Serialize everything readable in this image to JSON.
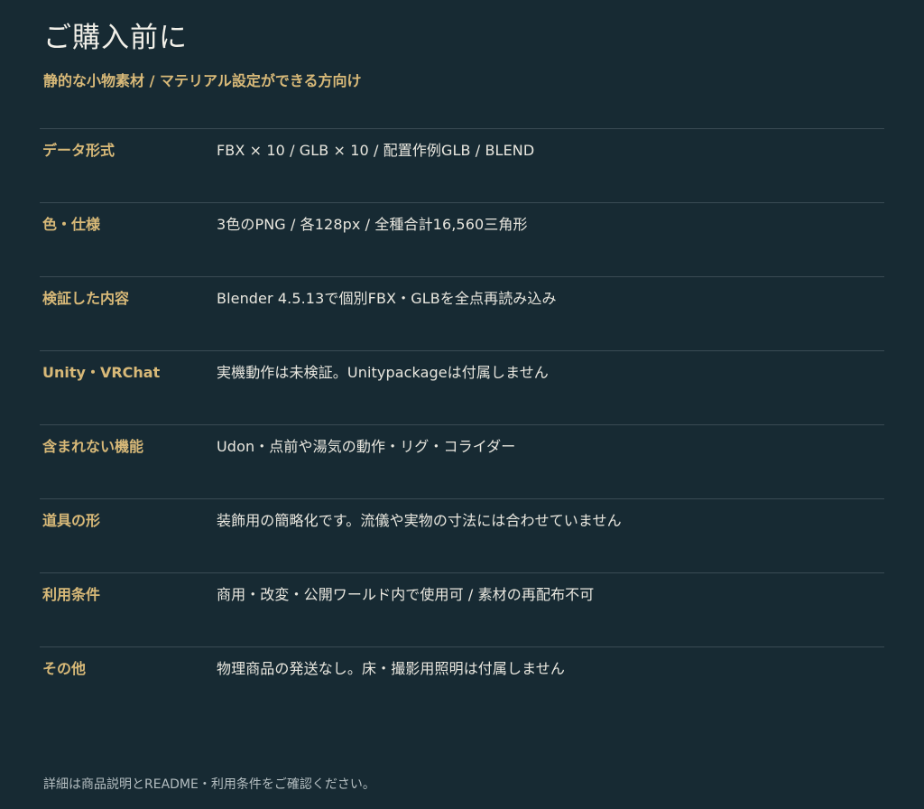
{
  "header": {
    "title": "ご購入前に",
    "subtitle": "静的な小物素材 / マテリアル設定ができる方向け"
  },
  "specs": [
    {
      "label": "データ形式",
      "value": "FBX × 10 / GLB × 10 / 配置作例GLB / BLEND"
    },
    {
      "label": "色・仕様",
      "value": "3色のPNG / 各128px / 全種合計16,560三角形"
    },
    {
      "label": "検証した内容",
      "value": "Blender 4.5.13で個別FBX・GLBを全点再読み込み"
    },
    {
      "label": "Unity・VRChat",
      "value": "実機動作は未検証。Unitypackageは付属しません"
    },
    {
      "label": "含まれない機能",
      "value": "Udon・点前や湯気の動作・リグ・コライダー"
    },
    {
      "label": "道具の形",
      "value": "装飾用の簡略化です。流儀や実物の寸法には合わせていません"
    },
    {
      "label": "利用条件",
      "value": "商用・改変・公開ワールド内で使用可 / 素材の再配布不可"
    },
    {
      "label": "その他",
      "value": "物理商品の発送なし。床・撮影用照明は付属しません"
    }
  ],
  "footer": {
    "note": "詳細は商品説明とREADME・利用条件をご確認ください。"
  },
  "colors": {
    "background": "#172a33",
    "accent": "#d8b978",
    "text": "#e9e7df",
    "divider": "#3a4b54"
  }
}
